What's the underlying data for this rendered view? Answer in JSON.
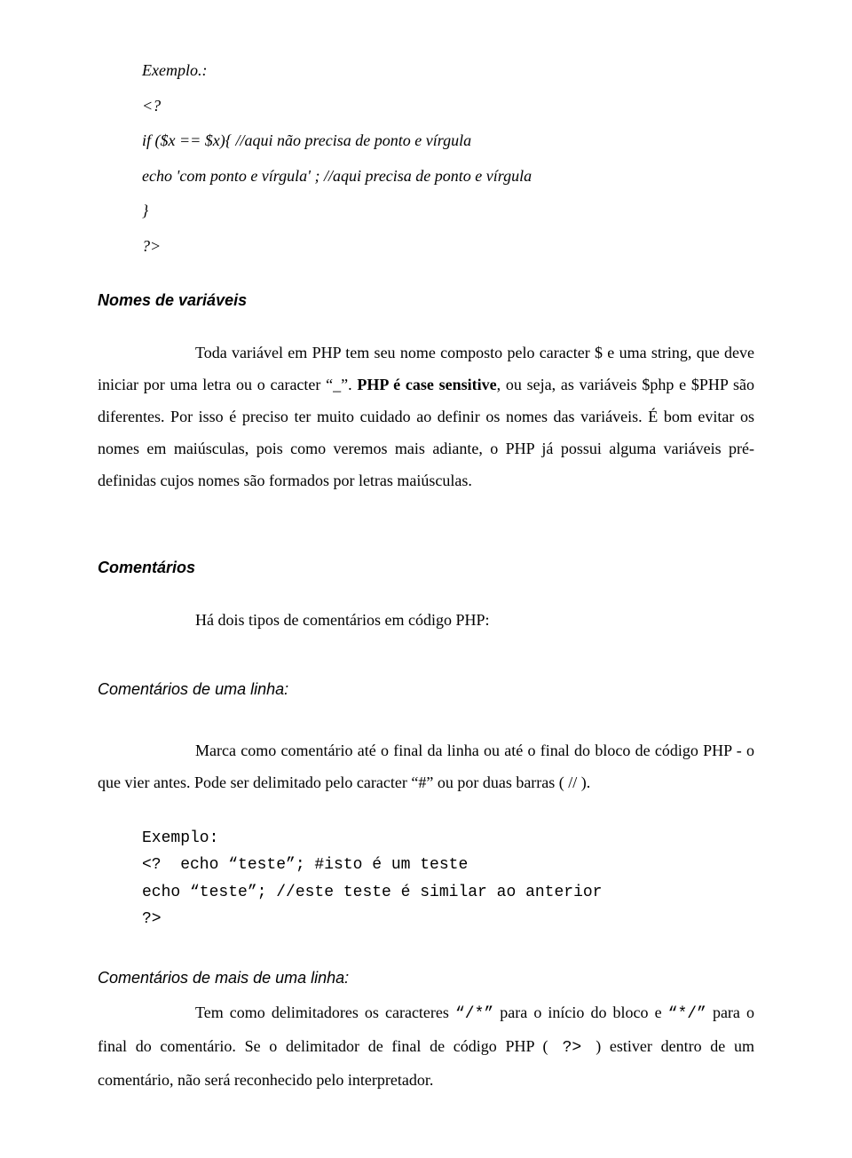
{
  "ex1": {
    "l1": "Exemplo.:",
    "l2": "<?",
    "l3": "if ($x == $x){  //aqui não precisa de ponto e vírgula",
    "l4": "echo 'com ponto e vírgula' ; //aqui precisa de ponto e vírgula",
    "l5": "}",
    "l6": "?>"
  },
  "section1": {
    "title": "Nomes de variáveis",
    "p1a": "Toda variável em PHP tem seu nome composto pelo caracter $ e uma string, que deve iniciar por uma letra ou o caracter “_”. ",
    "p1b": "PHP é case sensitive",
    "p1c": ", ou seja, as variáveis $php e $PHP são diferentes. Por isso é preciso ter muito cuidado ao definir os nomes das variáveis. É bom evitar os nomes em maiúsculas, pois como veremos mais adiante, o PHP já possui alguma variáveis pré-definidas cujos nomes são formados por letras maiúsculas."
  },
  "section2": {
    "title": "Comentários",
    "p1": "Há dois tipos de comentários em código PHP:"
  },
  "section3": {
    "title": "Comentários de uma linha:",
    "p1": "Marca como comentário até o final da linha ou até o final do bloco de código PHP - o que vier antes. Pode ser delimitado pelo caracter “#” ou por duas barras ( // )."
  },
  "ex2": {
    "l1": "Exemplo:",
    "l2": "<?  echo “teste”; #isto é um teste",
    "l3": "echo “teste”; //este teste é similar ao anterior",
    "l4": "?>"
  },
  "section4": {
    "title": "Comentários de mais de uma linha:",
    "p1a": "Tem como delimitadores os caracteres ",
    "p1b": "“/*”",
    "p1c": " para o início do bloco e ",
    "p1d": "“*/”",
    "p1e": " para o final do comentário. Se o delimitador de final de código PHP (",
    "p1f": " ?> ",
    "p1g": ") estiver dentro de um comentário, não será reconhecido pelo interpretador."
  }
}
